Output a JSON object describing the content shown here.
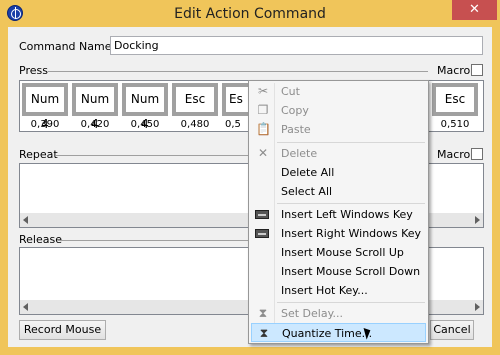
{
  "window": {
    "title": "Edit Action Command",
    "close_glyph": "✕"
  },
  "command": {
    "label": "Command Name",
    "value": "Docking"
  },
  "press": {
    "label": "Press",
    "macro_label": "Macro",
    "keys": [
      {
        "label": "Num 4",
        "time": "0,390"
      },
      {
        "label": "Num 4",
        "time": "0,420"
      },
      {
        "label": "Num 4",
        "time": "0,450"
      },
      {
        "label": "Esc",
        "time": "0,480"
      },
      {
        "label": "Es",
        "time": "0,5"
      },
      {
        "label": "Esc",
        "time": "0,510"
      }
    ]
  },
  "repeat": {
    "label": "Repeat",
    "macro_label": "Macro"
  },
  "release": {
    "label": "Release"
  },
  "buttons": {
    "record": "Record Mouse",
    "cancel": "Cancel"
  },
  "context_menu": {
    "cut": "Cut",
    "copy": "Copy",
    "paste": "Paste",
    "delete": "Delete",
    "delete_all": "Delete All",
    "select_all": "Select All",
    "insert_left_win": "Insert Left Windows Key",
    "insert_right_win": "Insert Right Windows Key",
    "insert_scroll_up": "Insert Mouse Scroll Up",
    "insert_scroll_down": "Insert Mouse Scroll Down",
    "insert_hot_key": "Insert Hot Key...",
    "set_delay": "Set Delay...",
    "quantize_time": "Quantize Time..."
  },
  "icons": {
    "cut": "✂",
    "copy": "❐",
    "paste": "📋",
    "delete": "✕",
    "hourglass": "⧗"
  }
}
